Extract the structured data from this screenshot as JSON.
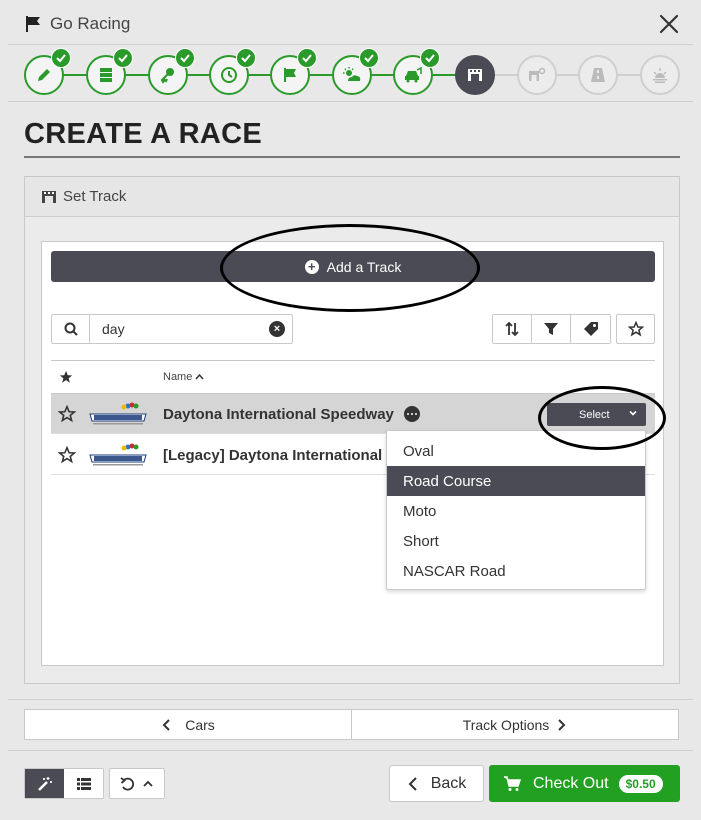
{
  "window": {
    "title": "Go Racing"
  },
  "steps": [
    {
      "icon": "pencil-icon",
      "state": "done"
    },
    {
      "icon": "server-icon",
      "state": "done"
    },
    {
      "icon": "key-icon",
      "state": "done"
    },
    {
      "icon": "clock-icon",
      "state": "done"
    },
    {
      "icon": "flag-icon",
      "state": "done"
    },
    {
      "icon": "weather-icon",
      "state": "done"
    },
    {
      "icon": "car-icon",
      "state": "done"
    },
    {
      "icon": "track-icon",
      "state": "active"
    },
    {
      "icon": "track-settings-icon",
      "state": "future"
    },
    {
      "icon": "road-icon",
      "state": "future"
    },
    {
      "icon": "sunrise-icon",
      "state": "future"
    }
  ],
  "page": {
    "title": "CREATE A RACE"
  },
  "panel": {
    "heading": "Set Track"
  },
  "add_track": {
    "label": "Add a Track"
  },
  "search": {
    "value": "day"
  },
  "table": {
    "name_header": "Name"
  },
  "tracks": [
    {
      "name": "Daytona International Speedway",
      "selected": true
    },
    {
      "name": "[Legacy] Daytona International",
      "selected": false
    }
  ],
  "select_button": {
    "label": "Select"
  },
  "config_options": [
    {
      "label": "Oval",
      "highlighted": false
    },
    {
      "label": "Road Course",
      "highlighted": true
    },
    {
      "label": "Moto",
      "highlighted": false
    },
    {
      "label": "Short",
      "highlighted": false
    },
    {
      "label": "NASCAR Road",
      "highlighted": false
    }
  ],
  "nav": {
    "prev_label": "Cars",
    "next_label": "Track Options"
  },
  "footer": {
    "back_label": "Back",
    "checkout_label": "Check Out",
    "price": "$0.50"
  },
  "colors": {
    "accent": "#22a022",
    "dark": "#4b4b55"
  }
}
